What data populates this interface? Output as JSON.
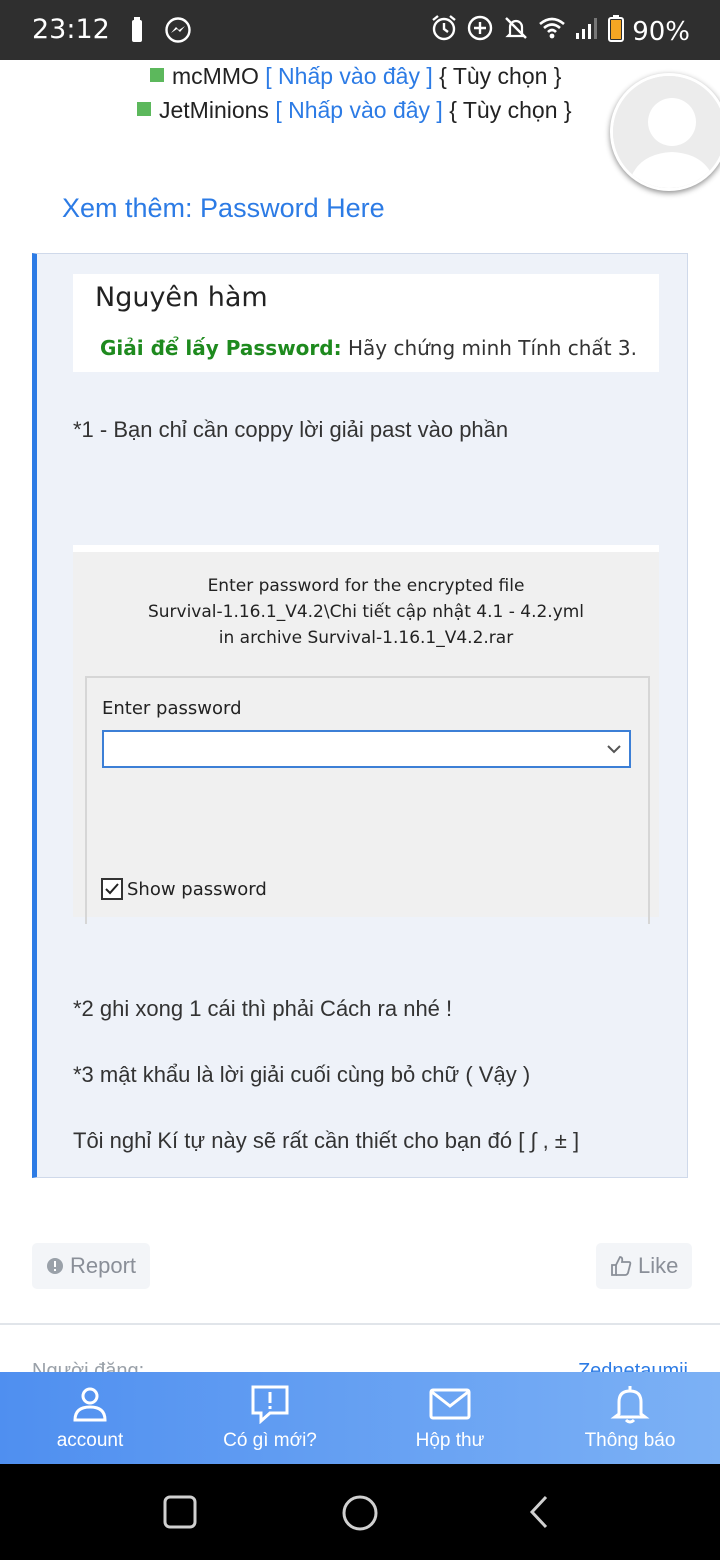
{
  "status_bar": {
    "time": "23:12",
    "battery": "90%"
  },
  "plugins": [
    {
      "name": "mcMMO",
      "link": "[ Nhấp vào đây ]",
      "option": "{ Tùy chọn }"
    },
    {
      "name": "JetMinions",
      "link": "[ Nhấp vào đây ]",
      "option": "{ Tùy chọn }"
    }
  ],
  "see_more": "Xem thêm: Password Here",
  "quote": {
    "image1": {
      "title": "Nguyên hàm",
      "prompt_bold": "Giải để lấy Password:",
      "prompt_rest": "Hãy chứng minh Tính chất 3."
    },
    "note1": "*1 - Bạn chỉ cần coppy lời giải past vào phần",
    "dialog": {
      "line1": "Enter password for the encrypted file",
      "line2": "Survival-1.16.1_V4.2\\Chi tiết cập nhật 4.1 - 4.2.yml",
      "line3": "in archive Survival-1.16.1_V4.2.rar",
      "field_label": "Enter password",
      "field_value": "",
      "show_password_label": "Show password",
      "show_password_checked": true
    },
    "note2": "*2 ghi xong 1 cái thì phải Cách ra nhé !",
    "note3": "*3 mật khẩu là lời giải cuối cùng bỏ chữ ( Vậy )",
    "note4": "Tôi nghỉ Kí tự này sẽ rất cần thiết cho bạn đó [ ∫ , ± ]"
  },
  "actions": {
    "report_label": "Report",
    "like_label": "Like"
  },
  "poster_row": {
    "left": "Người đăng:",
    "right": "Zednetaumii"
  },
  "bottom_nav": [
    {
      "label": "account",
      "icon": "person-icon"
    },
    {
      "label": "Có gì mới?",
      "icon": "chat-alert-icon"
    },
    {
      "label": "Hộp thư",
      "icon": "mail-icon"
    },
    {
      "label": "Thông báo",
      "icon": "bell-icon"
    }
  ],
  "colors": {
    "accent": "#2c7be5",
    "plugin_square": "#5cb85c",
    "nav_gradient_start": "#4f8ff0",
    "nav_gradient_end": "#7cb1f5"
  }
}
